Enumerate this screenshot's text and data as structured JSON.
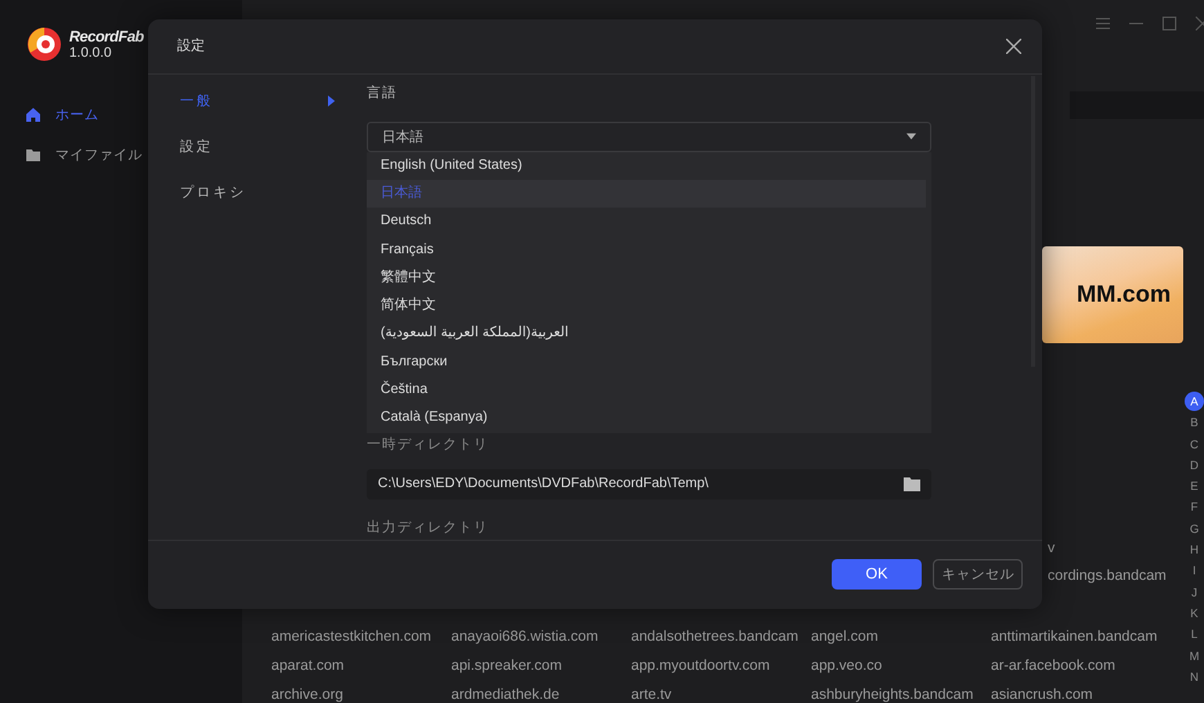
{
  "sidebar": {
    "app_name": "RecordFab",
    "version": "1.0.0.0",
    "items": [
      {
        "label": "ホーム",
        "selected": true
      },
      {
        "label": "マイファイル",
        "selected": false
      }
    ]
  },
  "main": {
    "banner_text": "MM.com",
    "partial_sites": [
      "v",
      "cordings.bandcam"
    ],
    "sites": [
      [
        "americastestkitchen.com",
        "anayaoi686.wistia.com",
        "andalsothetrees.bandcam",
        "angel.com",
        "anttimartikainen.bandcam"
      ],
      [
        "aparat.com",
        "api.spreaker.com",
        "app.myoutdoortv.com",
        "app.veo.co",
        "ar-ar.facebook.com"
      ],
      [
        "archive.org",
        "ardmediathek.de",
        "arte.tv",
        "ashburyheights.bandcam",
        "asiancrush.com"
      ]
    ],
    "alphabet": [
      {
        "letter": "A",
        "selected": true
      },
      {
        "letter": "B",
        "selected": false
      },
      {
        "letter": "C",
        "selected": false
      },
      {
        "letter": "D",
        "selected": false
      },
      {
        "letter": "E",
        "selected": false
      },
      {
        "letter": "F",
        "selected": false
      },
      {
        "letter": "G",
        "selected": false
      },
      {
        "letter": "H",
        "selected": false
      },
      {
        "letter": "I",
        "selected": false
      },
      {
        "letter": "J",
        "selected": false
      },
      {
        "letter": "K",
        "selected": false
      },
      {
        "letter": "L",
        "selected": false
      },
      {
        "letter": "M",
        "selected": false
      },
      {
        "letter": "N",
        "selected": false
      }
    ]
  },
  "dialog": {
    "title": "設定",
    "nav": [
      {
        "label": "一般",
        "selected": true
      },
      {
        "label": "設定",
        "selected": false
      },
      {
        "label": "プロキシ",
        "selected": false
      }
    ],
    "language_label": "言語",
    "language_value": "日本語",
    "language_options": [
      {
        "label": "English (United States)",
        "selected": false
      },
      {
        "label": "日本語",
        "selected": true
      },
      {
        "label": "Deutsch",
        "selected": false
      },
      {
        "label": "Français",
        "selected": false
      },
      {
        "label": "繁體中文",
        "selected": false
      },
      {
        "label": "简体中文",
        "selected": false
      },
      {
        "label": "العربية(المملكة العربية السعودية)",
        "selected": false
      },
      {
        "label": "Български",
        "selected": false
      },
      {
        "label": "Čeština",
        "selected": false
      },
      {
        "label": "Català (Espanya)",
        "selected": false
      }
    ],
    "temp_dir_label": "一時ディレクトリ",
    "temp_dir": "C:\\Users\\EDY\\Documents\\DVDFab\\RecordFab\\Temp\\",
    "output_dir_label": "出力ディレクトリ",
    "buttons": [
      {
        "label": "OK",
        "kind": "primary"
      },
      {
        "label": "キャンセル",
        "kind": "secondary"
      }
    ]
  }
}
